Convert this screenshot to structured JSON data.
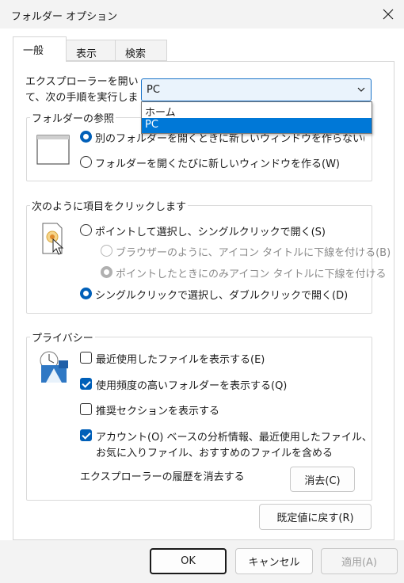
{
  "window": {
    "title": "フォルダー オプション"
  },
  "tabs": [
    {
      "label": "一般",
      "active": true
    },
    {
      "label": "表示",
      "active": false
    },
    {
      "label": "検索",
      "active": false
    }
  ],
  "open_explorer": {
    "label": "エクスプローラーを開いて、次の手順を実行しま",
    "selected_value": "PC",
    "options": [
      {
        "label": "ホーム",
        "selected": false
      },
      {
        "label": "PC",
        "selected": true
      }
    ]
  },
  "browse_folders": {
    "title": "フォルダーの参照",
    "options": [
      {
        "label": "別のフォルダーを開くときに新しいウィンドウを作らない(M)",
        "checked": true
      },
      {
        "label": "フォルダーを開くたびに新しいウィンドウを作る(W)",
        "checked": false
      }
    ]
  },
  "click_items": {
    "title": "次のように項目をクリックします",
    "single_click": {
      "label": "ポイントして選択し、シングルクリックで開く(S)",
      "checked": false
    },
    "sub_options": [
      {
        "label": "ブラウザーのように、アイコン タイトルに下線を付ける(B)",
        "checked": false
      },
      {
        "label": "ポイントしたときにのみアイコン タイトルに下線を付ける",
        "checked": true
      }
    ],
    "double_click": {
      "label": "シングルクリックで選択し、ダブルクリックで開く(D)",
      "checked": true
    }
  },
  "privacy": {
    "title": "プライバシー",
    "options": [
      {
        "label": "最近使用したファイルを表示する(E)",
        "checked": false
      },
      {
        "label": "使用頻度の高いフォルダーを表示する(Q)",
        "checked": true
      },
      {
        "label": "推奨セクションを表示する",
        "checked": false
      },
      {
        "label": "アカウント(O) ベースの分析情報、最近使用したファイル、",
        "label2": "お気に入りファイル、おすすめのファイルを含める",
        "checked": true
      }
    ],
    "clear_history_label": "エクスプローラーの履歴を消去する",
    "clear_button": "消去(C)"
  },
  "restore_defaults": "既定値に戻す(R)",
  "footer": {
    "ok": "OK",
    "cancel": "キャンセル",
    "apply": "適用(A)"
  },
  "colors": {
    "accent": "#005fb8",
    "selection": "#0078d7"
  },
  "icons": [
    "close-icon",
    "chevron-down-icon",
    "window-icon",
    "click-pointer-icon",
    "privacy-shield-icon"
  ]
}
